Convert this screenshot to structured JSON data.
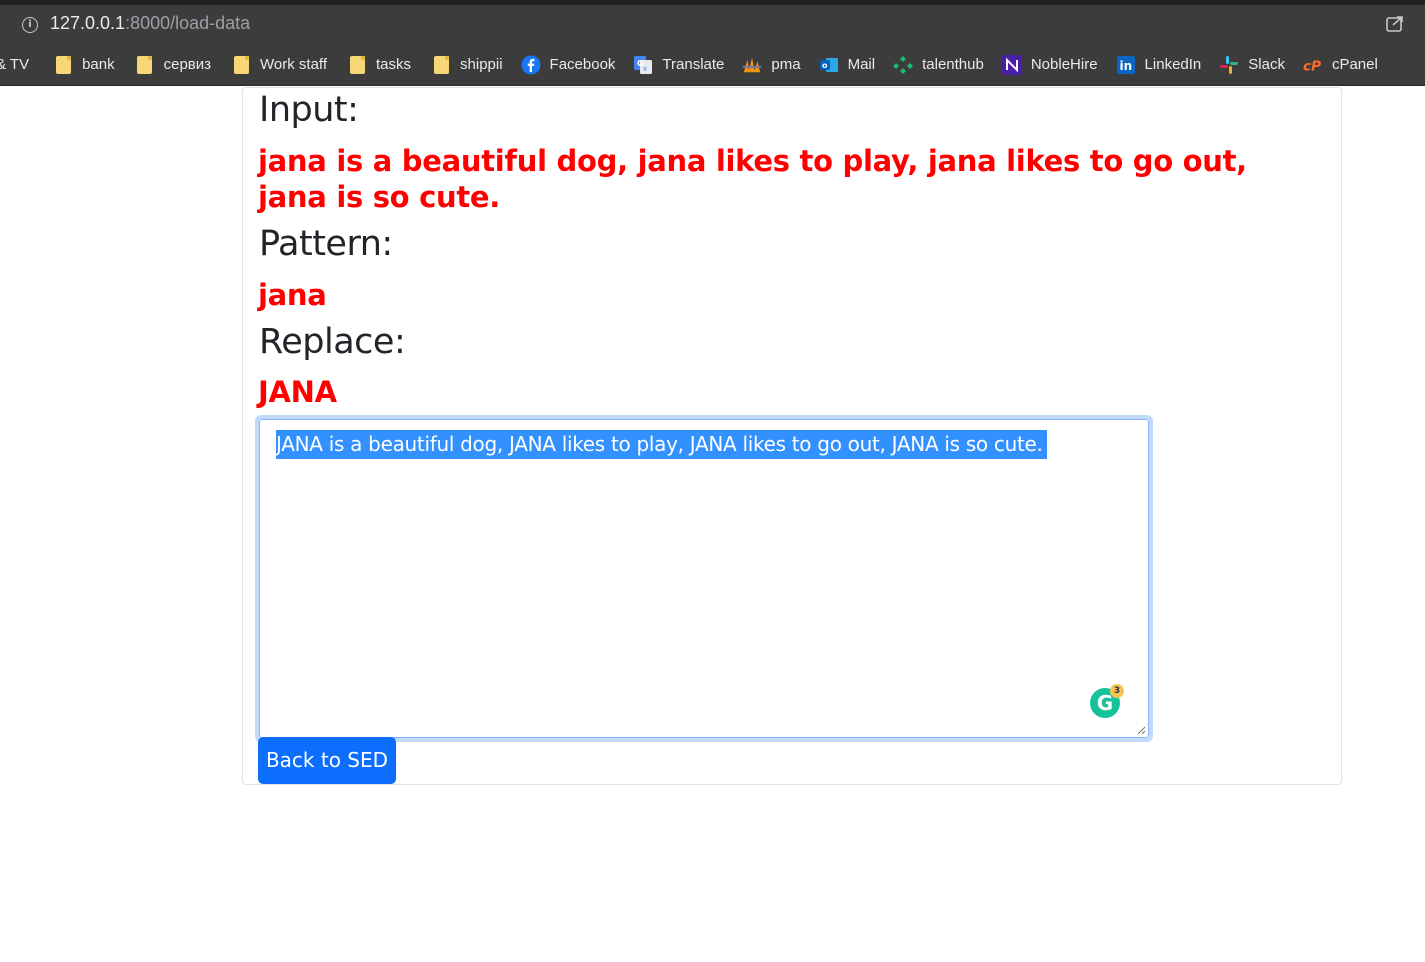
{
  "browser": {
    "url_host": "127.0.0.1",
    "url_rest": ":8000/load-data"
  },
  "bookmarks": [
    {
      "label": "& TV",
      "icon": "tv-icon"
    },
    {
      "label": "bank",
      "icon": "folder-icon"
    },
    {
      "label": "сервиз",
      "icon": "folder-icon"
    },
    {
      "label": "Work staff",
      "icon": "folder-icon"
    },
    {
      "label": "tasks",
      "icon": "folder-icon"
    },
    {
      "label": "shippii",
      "icon": "folder-icon"
    },
    {
      "label": "Facebook",
      "icon": "facebook-icon"
    },
    {
      "label": "Translate",
      "icon": "translate-icon"
    },
    {
      "label": "pma",
      "icon": "phpmyadmin-icon"
    },
    {
      "label": "Mail",
      "icon": "outlook-icon"
    },
    {
      "label": "talenthub",
      "icon": "talenthub-icon"
    },
    {
      "label": "NobleHire",
      "icon": "noblehire-icon"
    },
    {
      "label": "LinkedIn",
      "icon": "linkedin-icon"
    },
    {
      "label": "Slack",
      "icon": "slack-icon"
    },
    {
      "label": "cPanel",
      "icon": "cpanel-icon"
    }
  ],
  "page": {
    "input_label": "Input:",
    "input_value_line1": "jana is a beautiful dog, jana likes to play, jana likes to go out,",
    "input_value_line2": "jana is so cute.",
    "pattern_label": "Pattern:",
    "pattern_value": "jana",
    "replace_label": "Replace:",
    "replace_value": "JANA",
    "output_text": "JANA is a beautiful dog, JANA likes to play, JANA likes to go out, JANA is so cute.",
    "grammarly_count": "3",
    "back_button": "Back to SED"
  },
  "colors": {
    "value_red": "#ff0000",
    "button_blue": "#0d6efd",
    "selection_blue": "#3390ff"
  }
}
